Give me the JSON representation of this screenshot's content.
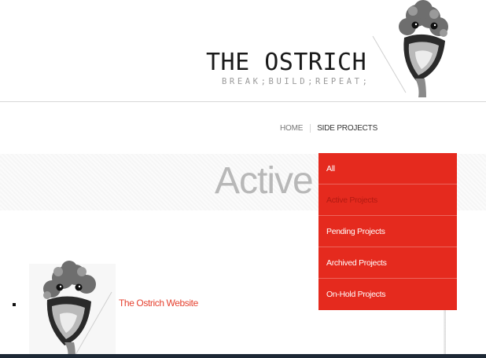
{
  "site": {
    "title": "THE OSTRICH",
    "tagline": "BREAK;BUILD;REPEAT;"
  },
  "nav": {
    "items": [
      {
        "label": "HOME"
      },
      {
        "label": "SIDE PROJECTS"
      }
    ]
  },
  "hero": {
    "title": "Active"
  },
  "dropdown": {
    "items": [
      {
        "label": "All"
      },
      {
        "label": "Active Projects"
      },
      {
        "label": "Pending Projects"
      },
      {
        "label": "Archived Projects"
      },
      {
        "label": "On-Hold Projects"
      }
    ],
    "active_index": 1
  },
  "projects": [
    {
      "name": "The Ostrich Website"
    }
  ],
  "colors": {
    "accent": "#e52a1e",
    "link": "#e5412f",
    "title": "#1b1b1b"
  },
  "icons": {
    "logo": "ostrich-logo-icon",
    "thumbnail": "ostrich-thumbnail-icon"
  }
}
